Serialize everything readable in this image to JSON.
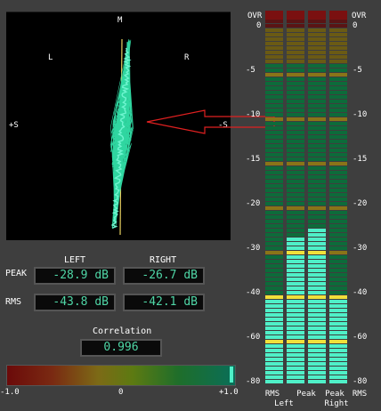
{
  "scope": {
    "top": "M",
    "left": "L",
    "right": "R",
    "plus_s": "+S",
    "minus_s": "-S"
  },
  "readouts": {
    "left_header": "LEFT",
    "right_header": "RIGHT",
    "peak_label": "PEAK",
    "rms_label": "RMS",
    "peak_left": "-28.9 dB",
    "peak_right": "-26.7 dB",
    "rms_left": "-43.8 dB",
    "rms_right": "-42.1 dB"
  },
  "correlation": {
    "label": "Correlation",
    "value": "0.996",
    "level": 0.996,
    "scale_min": "-1.0",
    "scale_mid": "0",
    "scale_max": "+1.0"
  },
  "meters": {
    "ovr": "OVR",
    "scale": [
      "0",
      "-5",
      "-10",
      "-15",
      "-20",
      "-30",
      "-40",
      "-60",
      "-80"
    ],
    "levels_db": {
      "rms_left": -43.8,
      "peak_left": -28.9,
      "peak_right": -26.7,
      "rms_right": -42.1
    },
    "footer": {
      "rms": "RMS",
      "peak": "Peak",
      "left": "Left",
      "right": "Right"
    }
  },
  "colors": {
    "meter_lit": "#4ff0c8",
    "meter_dim": "#0d6b3a",
    "meter_yellow": "#f0e03a",
    "meter_red": "#7a1010",
    "annotation": "#e02020",
    "readout_text": "#4fd6a6"
  }
}
